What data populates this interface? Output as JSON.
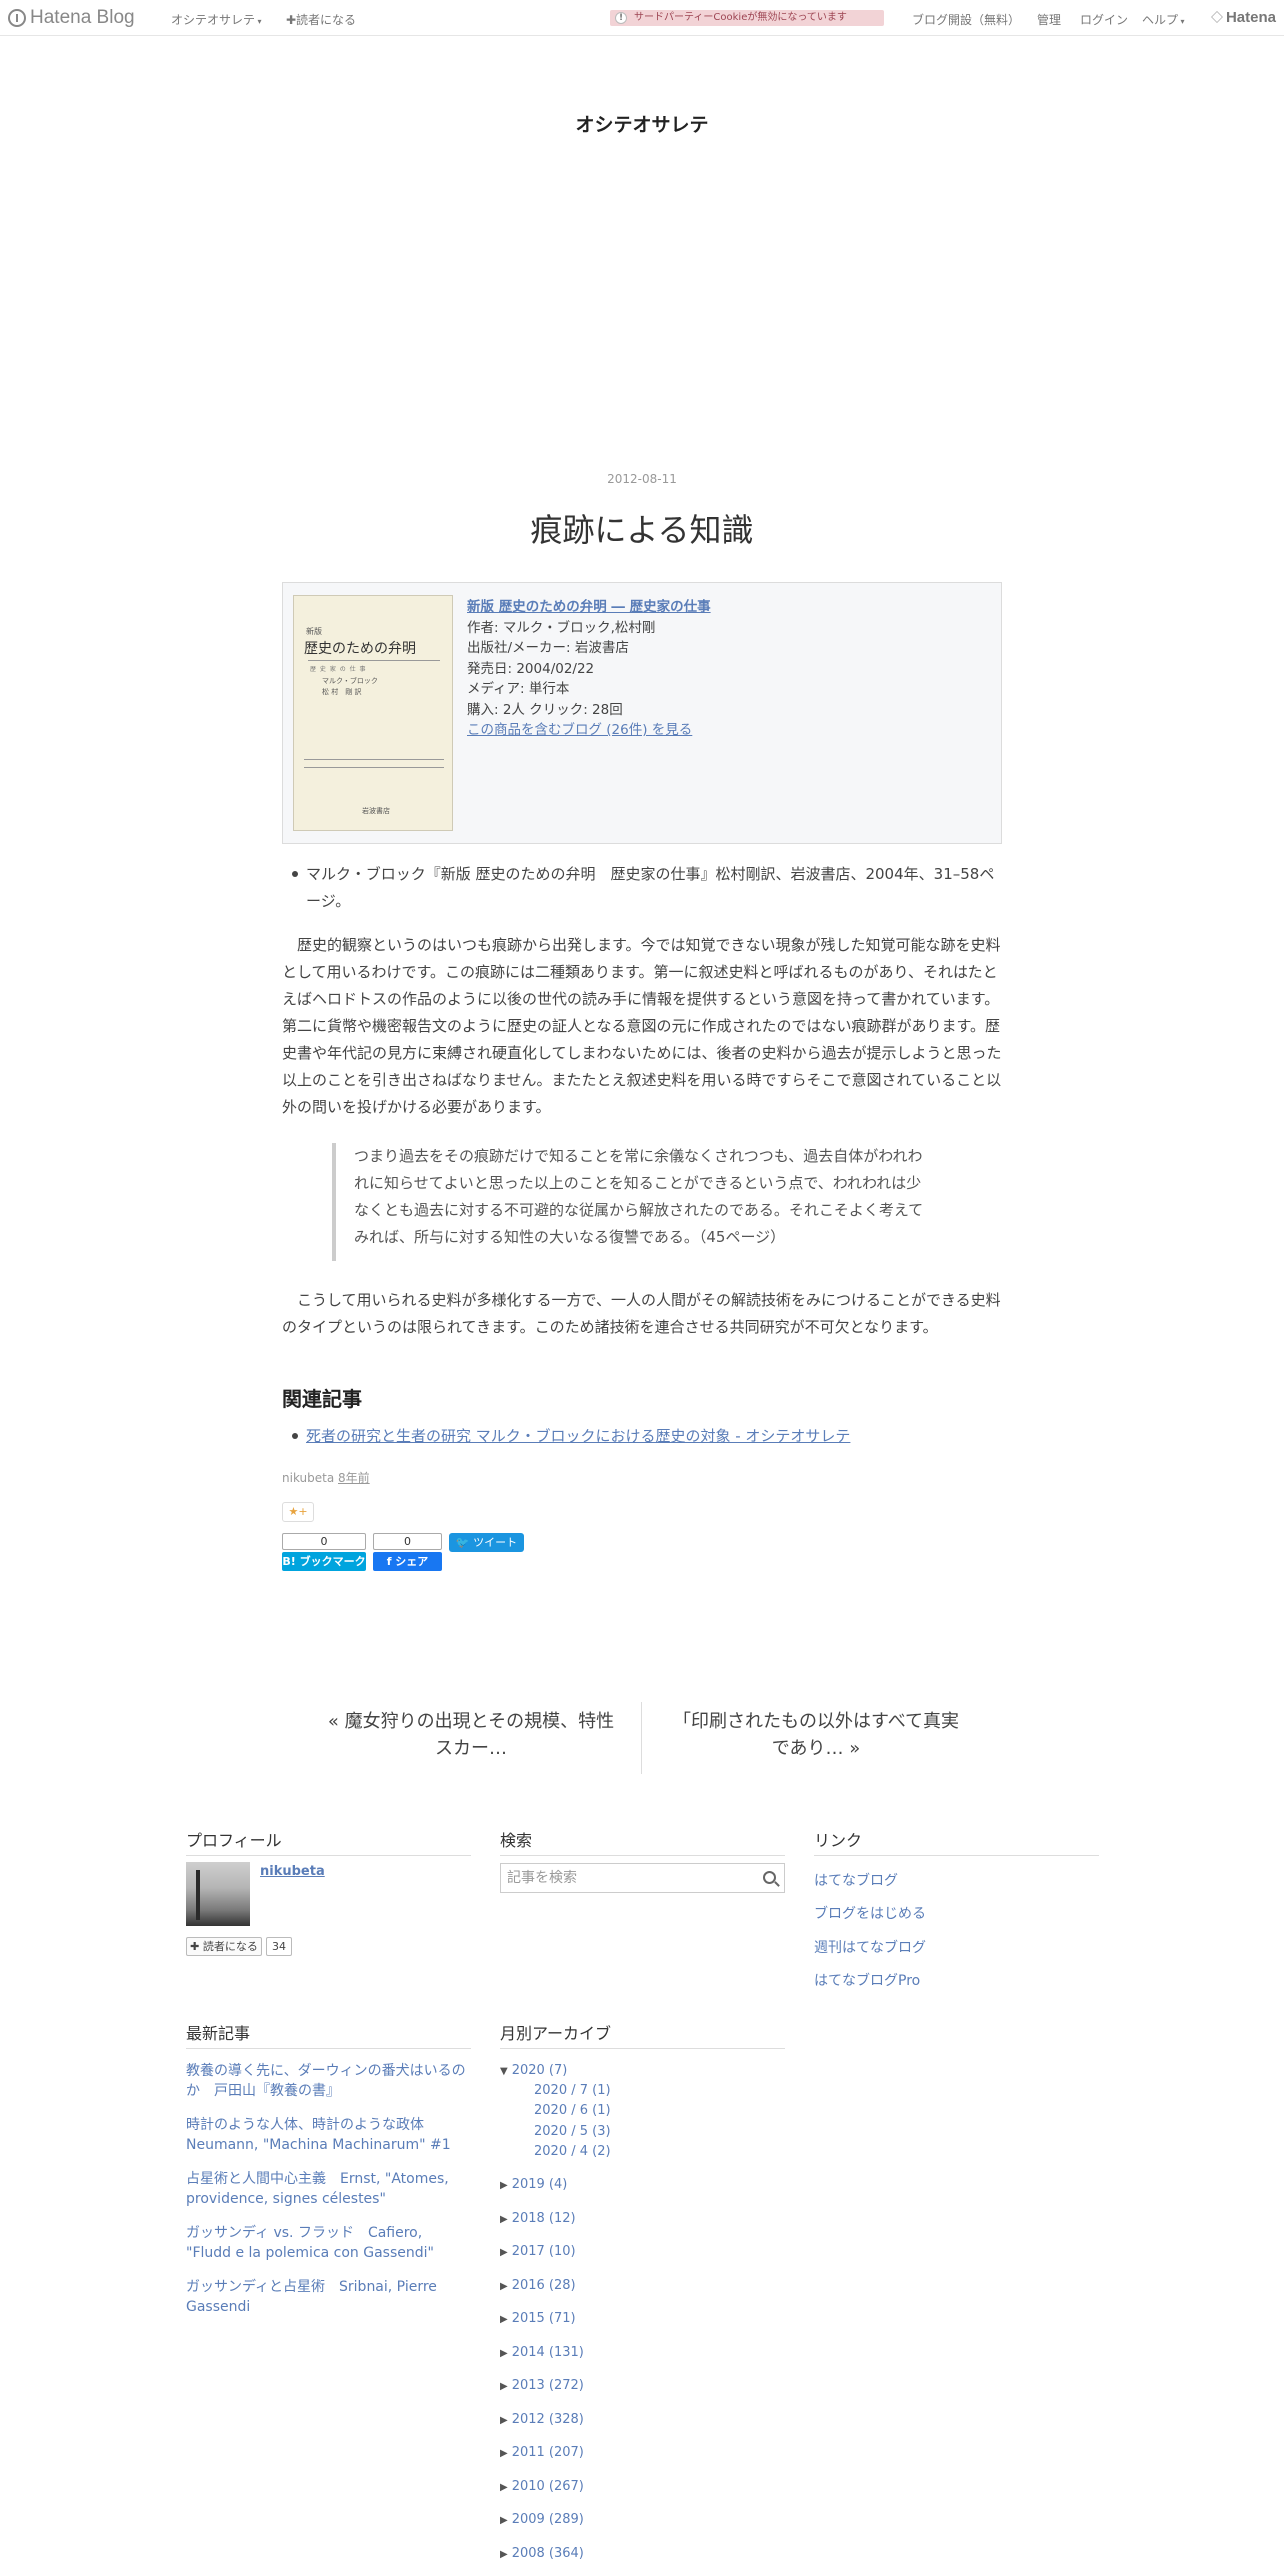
{
  "topbar": {
    "logo": "Hatena Blog",
    "blog_menu": "オシテオサレテ",
    "reader_link": "✚読者になる",
    "cookie_notice": "サードパーティーCookieが無効になっています",
    "open_blog": "ブログ開設（無料）",
    "admin": "管理",
    "login": "ログイン",
    "help": "ヘルプ",
    "hatena": "Hatena"
  },
  "blog": {
    "title": "オシテオサレテ"
  },
  "entry": {
    "date": "2012-08-11",
    "title": "痕跡による知識",
    "amazon": {
      "cover": {
        "tag": "新版",
        "title": "歴史のための弁明",
        "subtitle": "歴 史 家 の 仕 事",
        "author1": "マルク・ブロック",
        "author2": "松 村　剛 訳",
        "publisher": "岩波書店"
      },
      "book_title": "新版 歴史のための弁明 ― 歴史家の仕事",
      "author": "作者: マルク・ブロック,松村剛",
      "publisher": "出版社/メーカー: 岩波書店",
      "release": "発売日: 2004/02/22",
      "media": "メディア: 単行本",
      "stats": "購入: 2人 クリック: 28回",
      "more": "この商品を含むブログ (26件) を見る"
    },
    "bullet": "マルク・ブロック『新版 歴史のための弁明　歴史家の仕事』松村剛訳、岩波書店、2004年、31–58ページ。",
    "para1": "歴史的観察というのはいつも痕跡から出発します。今では知覚できない現象が残した知覚可能な跡を史料として用いるわけです。この痕跡には二種類あります。第一に叙述史料と呼ばれるものがあり、それはたとえばヘロドトスの作品のように以後の世代の読み手に情報を提供するという意図を持って書かれています。第二に貨幣や機密報告文のように歴史の証人となる意図の元に作成されたのではない痕跡群があります。歴史書や年代記の見方に束縛され硬直化してしまわないためには、後者の史料から過去が提示しようと思った以上のことを引き出さねばなりません。またたとえ叙述史料を用いる時ですらそこで意図されていること以外の問いを投げかける必要があります。",
    "quote": "つまり過去をその痕跡だけで知ることを常に余儀なくされつつも、過去自体がわれわれに知らせてよいと思った以上のことを知ることができるという点で、われわれは少なくとも過去に対する不可避的な従属から解放されたのである。それこそよく考えてみれば、所与に対する知性の大いなる復讐である。（45ページ）",
    "para2": "こうして用いられる史料が多様化する一方で、一人の人間がその解読技術をみにつけることができる史料のタイプというのは限られてきます。このため諸技術を連合させる共同研究が不可欠となります。",
    "related_heading": "関連記事",
    "related_link": "死者の研究と生者の研究 マルク・ブロックにおける歴史の対象 - オシテオサレテ",
    "author": "nikubeta",
    "ago": "8年前",
    "star": "★+",
    "bookmark_count": "0",
    "bookmark_label": "B! ブックマーク",
    "share_count": "0",
    "share_label": "f  シェア",
    "tweet_label": "ツイート"
  },
  "pager": {
    "prev": "« 魔女狩りの出現とその規模、特性　スカー…",
    "next": "「印刷されたもの以外はすべて真実であり… »"
  },
  "sidebar": {
    "profile_title": "プロフィール",
    "profile_name": "nikubeta",
    "reader_button": "✚ 読者になる",
    "reader_count": "34",
    "search_title": "検索",
    "search_placeholder": "記事を検索",
    "links_title": "リンク",
    "links": [
      "はてなブログ",
      "ブログをはじめる",
      "週刊はてなブログ",
      "はてなブログPro"
    ],
    "recent_title": "最新記事",
    "recent": [
      "教養の導く先に、ダーウィンの番犬はいるのか　戸田山『教養の書』",
      "時計のような人体、時計のような政体　Neumann, \"Machina Machinarum\" #1",
      "占星術と人間中心主義　Ernst, \"Atomes, providence, signes célestes\"",
      "ガッサンディ vs. フラッド　Cafiero, \"Fludd e la polemica con Gassendi\"",
      "ガッサンディと占星術　Sribnai, Pierre Gassendi"
    ],
    "archive_title": "月別アーカイブ",
    "archive_open": "2020 (7)",
    "archive_months": [
      "2020 / 7 (1)",
      "2020 / 6 (1)",
      "2020 / 5 (3)",
      "2020 / 4 (2)"
    ],
    "archive_years": [
      "2019 (4)",
      "2018 (12)",
      "2017 (10)",
      "2016 (28)",
      "2015 (71)",
      "2014 (131)",
      "2013 (272)",
      "2012 (328)",
      "2011 (207)",
      "2010 (267)",
      "2009 (289)",
      "2008 (364)"
    ]
  }
}
